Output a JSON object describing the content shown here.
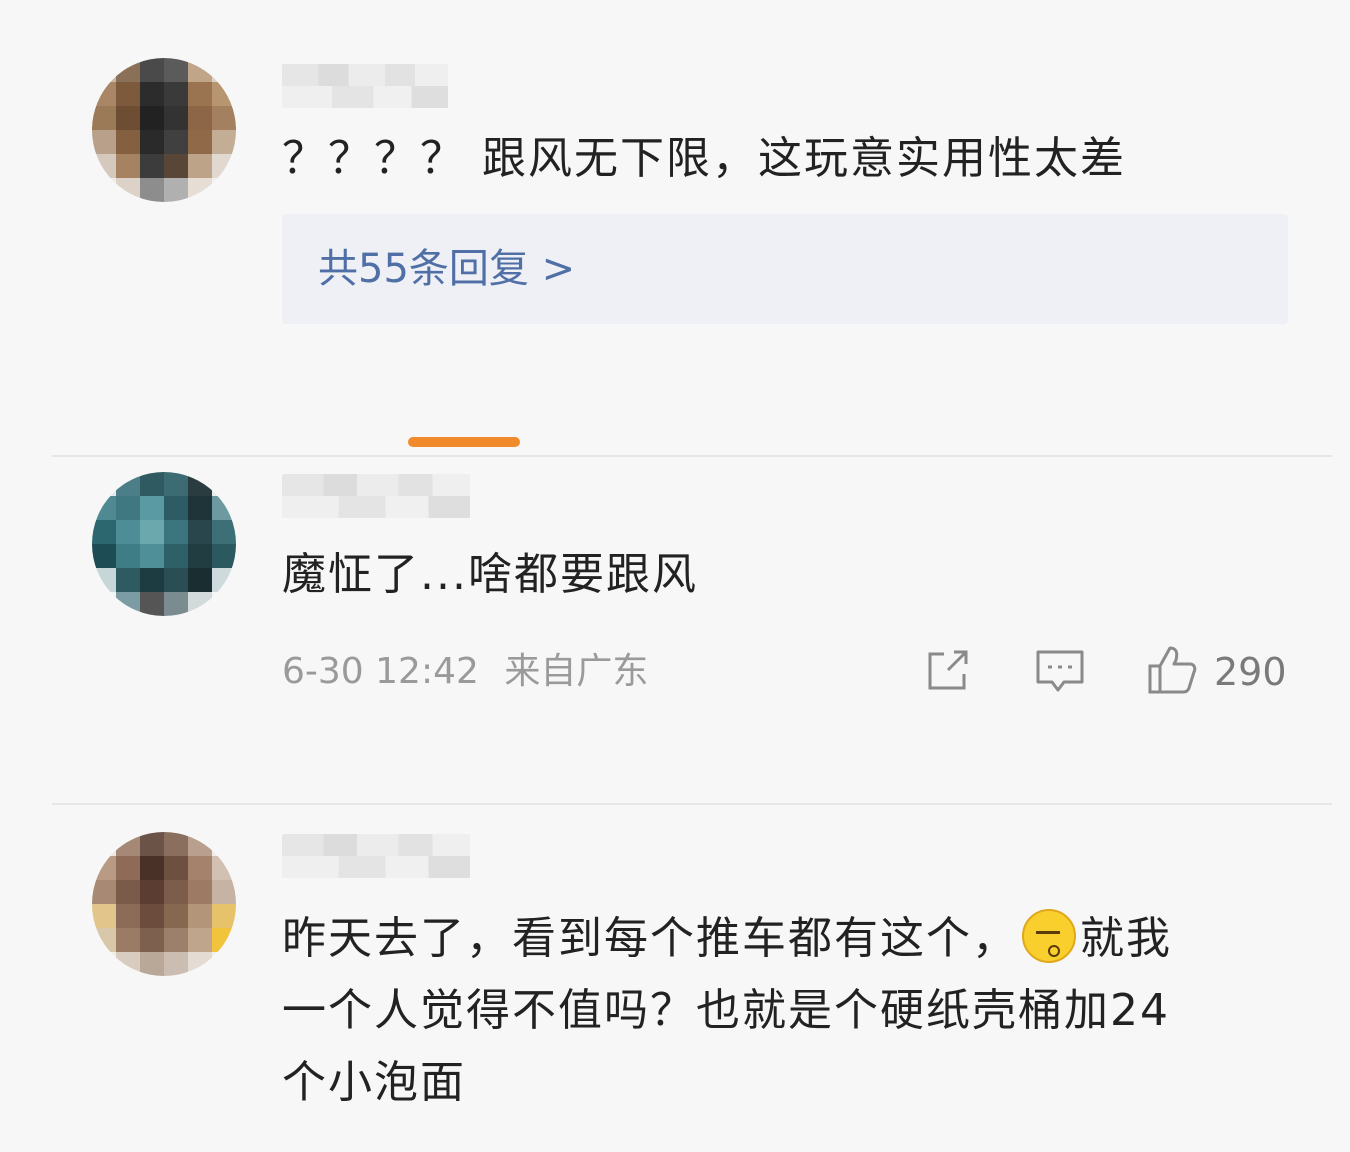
{
  "comments": [
    {
      "text": "？？？？ 跟风无下限，这玩意实用性太差",
      "replies": "共55条回复 >"
    },
    {
      "text": "魔怔了...啥都要跟风",
      "time": "6-30 12:42",
      "location": "来自广东",
      "likes": "290",
      "icons": [
        "share-icon",
        "comment-icon",
        "like-icon"
      ]
    },
    {
      "text_part1": "昨天去了，看到每个推车都有这个，",
      "text_part2": "就我",
      "text_line2": "一个人觉得不值吗？也就是个硬纸壳桶加24",
      "text_line3": "个小泡面",
      "emoji": "speechless-emoji"
    }
  ],
  "colors": {
    "reply_link": "#4f6fa6",
    "accent_orange": "#f08a2a",
    "meta_gray": "#9a9a9a"
  }
}
